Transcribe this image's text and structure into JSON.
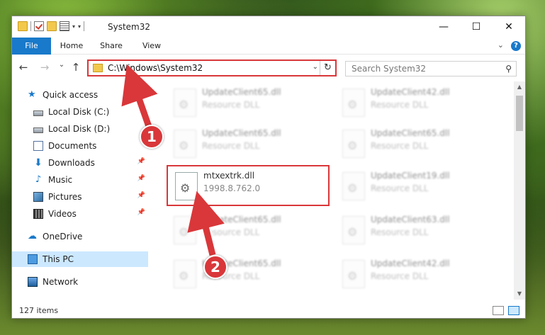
{
  "window": {
    "title": "System32"
  },
  "ribbon": {
    "tabs": [
      "File",
      "Home",
      "Share",
      "View"
    ],
    "help": "?"
  },
  "navigation": {
    "back": "←",
    "forward": "→",
    "recent": "⌄",
    "up": "↑"
  },
  "address": {
    "path": "C:\\Windows\\System32"
  },
  "search": {
    "placeholder": "Search System32"
  },
  "sidebar": {
    "items": [
      {
        "label": "Quick access",
        "icon": "star-icon"
      },
      {
        "label": "Local Disk (C:)",
        "icon": "drive-icon"
      },
      {
        "label": "Local Disk (D:)",
        "icon": "drive-icon"
      },
      {
        "label": "Documents",
        "icon": "document-icon"
      },
      {
        "label": "Downloads",
        "icon": "download-icon",
        "pinned": true
      },
      {
        "label": "Music",
        "icon": "music-icon",
        "pinned": true
      },
      {
        "label": "Pictures",
        "icon": "pictures-icon",
        "pinned": true
      },
      {
        "label": "Videos",
        "icon": "videos-icon",
        "pinned": true
      },
      {
        "label": "OneDrive",
        "icon": "cloud-icon"
      },
      {
        "label": "This PC",
        "icon": "computer-icon",
        "selected": true
      },
      {
        "label": "Network",
        "icon": "network-icon"
      }
    ]
  },
  "files": {
    "left": [
      {
        "name": "UpdateClient65.dll",
        "desc": "Resource DLL"
      },
      {
        "name": "UpdateClient65.dll",
        "desc": "Resource DLL"
      },
      {
        "name": "mtxextrk.dll",
        "desc": "1998.8.762.0"
      },
      {
        "name": "UpdateClient65.dll",
        "desc": "Resource DLL"
      },
      {
        "name": "UpdateClient65.dll",
        "desc": "Resource DLL"
      }
    ],
    "right": [
      {
        "name": "UpdateClient42.dll",
        "desc": "Resource DLL"
      },
      {
        "name": "UpdateClient65.dll",
        "desc": "Resource DLL"
      },
      {
        "name": "UpdateClient19.dll",
        "desc": "Resource DLL"
      },
      {
        "name": "UpdateClient63.dll",
        "desc": "Resource DLL"
      },
      {
        "name": "UpdateClient42.dll",
        "desc": "Resource DLL"
      }
    ]
  },
  "status": {
    "count": "127 items"
  },
  "annotations": {
    "step1": "1",
    "step2": "2",
    "color": "#d9373a"
  }
}
